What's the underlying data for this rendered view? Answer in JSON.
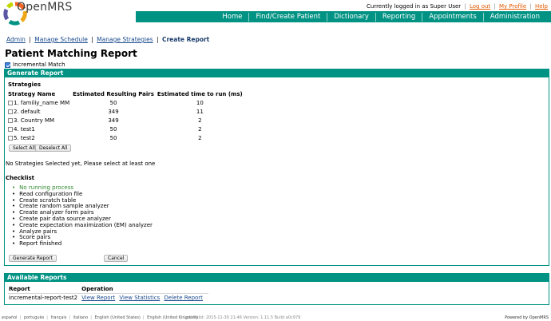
{
  "app": {
    "brand": "OpenMRS"
  },
  "userbar": {
    "logged_in": "Currently logged in as Super User",
    "logout": "Log out",
    "profile": "My Profile",
    "help": "Help"
  },
  "nav": [
    "Home",
    "Find/Create Patient",
    "Dictionary",
    "Reporting",
    "Appointments",
    "Administration"
  ],
  "subnav": {
    "admin": "Admin",
    "schedule": "Manage Schedule",
    "strategies": "Manage Strategies",
    "current": "Create Report"
  },
  "page_title": "Patient Matching Report",
  "incremental": {
    "label": "Incremental Match",
    "checked": true
  },
  "generate": {
    "header": "Generate Report",
    "strategies_title": "Strategies",
    "columns": [
      "Strategy Name",
      "Estimated Resulting Pairs",
      "Estimated time to run (ms)"
    ],
    "rows": [
      {
        "name": "1. familiy_name MM",
        "pairs": "50",
        "time": "10"
      },
      {
        "name": "2. default",
        "pairs": "349",
        "time": "11"
      },
      {
        "name": "3. Country MM",
        "pairs": "349",
        "time": "2"
      },
      {
        "name": "4. test1",
        "pairs": "50",
        "time": "2"
      },
      {
        "name": "5. test2",
        "pairs": "50",
        "time": "2"
      }
    ],
    "select_all": "Select All",
    "deselect_all": "Deselect All",
    "message": "No Strategies Selected yet, Please select at least one",
    "checklist_title": "Checklist",
    "checklist": [
      "No running process",
      "Read configuration file",
      "Create scratch table",
      "Create random sample analyzer",
      "Create analyzer form pairs",
      "Create pair data source analyzer",
      "Create expectation maximization (EM) analyzer",
      "Analyze pairs",
      "Score pairs",
      "Report finished"
    ],
    "generate_button": "Generate Report",
    "cancel_button": "Cancel"
  },
  "available": {
    "header": "Available Reports",
    "columns": [
      "Report",
      "Operation"
    ],
    "rows": [
      {
        "report": "incremental-report-test2",
        "ops": [
          "View Report",
          "View Statistics",
          "Delete Report"
        ]
      }
    ]
  },
  "footer": {
    "languages": [
      "español",
      "português",
      "français",
      "italiano",
      "English (United States)",
      "English (United Kingdom)"
    ],
    "build": "Last Build: 2015-11-30 21:46   Version: 1.11.5 Build a0c979",
    "powered": "Powered by OpenMRS"
  },
  "colors": {
    "accent": "#009384",
    "link": "#1b4b8f",
    "userlink": "#e05a00"
  }
}
